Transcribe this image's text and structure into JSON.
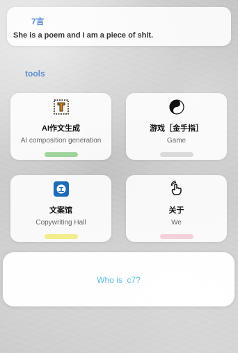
{
  "quote": {
    "title": "7言",
    "text": "She is a poem and I am a piece of shit."
  },
  "section": {
    "title": "tools"
  },
  "tools": [
    {
      "title": "AI作文生成",
      "subtitle": "AI composition generation",
      "icon": "letter-t-icon",
      "bar_color": "#9fd59a"
    },
    {
      "title": "游戏［金手指］",
      "subtitle": "Game",
      "icon": "yin-yang-icon",
      "bar_color": "#dadada"
    },
    {
      "title": "文案馆",
      "subtitle": "Copywriting Hall",
      "icon": "library-icon",
      "bar_color": "#f3ec8c"
    },
    {
      "title": "关于",
      "subtitle": "We",
      "icon": "touch-hand-icon",
      "bar_color": "#f4d1db"
    }
  ],
  "bottom_prompt": "Who is  c7?",
  "colors": {
    "accent_blue": "#5d8fd3",
    "link_blue": "#59bbe1"
  }
}
